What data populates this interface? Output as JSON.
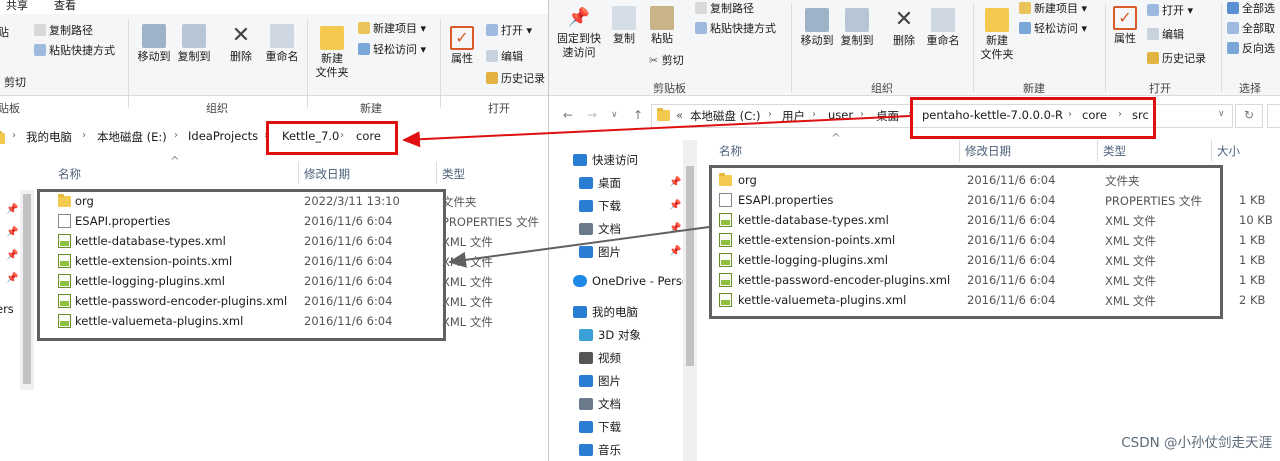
{
  "left": {
    "ribbon_tabs": [
      "共享",
      "查看"
    ],
    "ribbon": {
      "paste_partial": "贴",
      "cut": "剪切",
      "clipboard_label": "贴板",
      "copy_path": "复制路径",
      "paste_shortcut": "粘贴快捷方式",
      "move_to": "移动到",
      "copy_to": "复制到",
      "delete": "删除",
      "rename": "重命名",
      "organize_label": "组织",
      "new_folder": "新建\n文件夹",
      "new_item": "新建项目",
      "easy_access": "轻松访问",
      "new_label": "新建",
      "properties": "属性",
      "open": "打开",
      "edit": "编辑",
      "history": "历史记录",
      "open_label": "打开"
    },
    "breadcrumb": [
      "我的电脑",
      "本地磁盘 (E:)",
      "IdeaProjects",
      "Kettle_7.0",
      "core"
    ],
    "columns": {
      "name": "名称",
      "date": "修改日期",
      "type": "类型"
    },
    "nav_partial": "ers",
    "files": [
      {
        "name": "org",
        "date": "2022/3/11 13:10",
        "type": "文件夹",
        "kind": "folder"
      },
      {
        "name": "ESAPI.properties",
        "date": "2016/11/6 6:04",
        "type": "PROPERTIES 文件",
        "kind": "doc"
      },
      {
        "name": "kettle-database-types.xml",
        "date": "2016/11/6 6:04",
        "type": "XML 文件",
        "kind": "xml"
      },
      {
        "name": "kettle-extension-points.xml",
        "date": "2016/11/6 6:04",
        "type": "XML 文件",
        "kind": "xml"
      },
      {
        "name": "kettle-logging-plugins.xml",
        "date": "2016/11/6 6:04",
        "type": "XML 文件",
        "kind": "xml"
      },
      {
        "name": "kettle-password-encoder-plugins.xml",
        "date": "2016/11/6 6:04",
        "type": "XML 文件",
        "kind": "xml"
      },
      {
        "name": "kettle-valuemeta-plugins.xml",
        "date": "2016/11/6 6:04",
        "type": "XML 文件",
        "kind": "xml"
      }
    ]
  },
  "right": {
    "ribbon": {
      "pin_quick": "固定到快\n速访问",
      "copy": "复制",
      "paste": "粘贴",
      "copy_path": "复制路径",
      "paste_shortcut": "粘贴快捷方式",
      "cut": "剪切",
      "clipboard_label": "剪贴板",
      "move_to": "移动到",
      "copy_to": "复制到",
      "delete": "删除",
      "rename": "重命名",
      "organize_label": "组织",
      "new_folder": "新建\n文件夹",
      "new_item": "新建项目",
      "easy_access": "轻松访问",
      "new_label": "新建",
      "properties": "属性",
      "open": "打开",
      "edit": "编辑",
      "history": "历史记录",
      "open_label": "打开",
      "select_all": "全部选",
      "select_none": "全部取",
      "invert": "反向选",
      "select_label": "选择"
    },
    "breadcrumb_prefix": "«",
    "breadcrumb": [
      "本地磁盘 (C:)",
      "用户",
      "user",
      "桌面",
      "pentaho-kettle-7.0.0.0-R",
      "core",
      "src"
    ],
    "columns": {
      "name": "名称",
      "date": "修改日期",
      "type": "类型",
      "size": "大小"
    },
    "nav": [
      {
        "label": "快速访问",
        "icon": "star-icon",
        "color": "#2b7cd3"
      },
      {
        "label": "桌面",
        "icon": "desktop-icon",
        "color": "#2b7cd3",
        "pinned": true
      },
      {
        "label": "下载",
        "icon": "download-icon",
        "color": "#2b7cd3",
        "pinned": true
      },
      {
        "label": "文档",
        "icon": "document-icon",
        "color": "#6b7b8c",
        "pinned": true
      },
      {
        "label": "图片",
        "icon": "picture-icon",
        "color": "#2b7cd3",
        "pinned": true
      },
      {
        "label": "OneDrive - Perso",
        "icon": "cloud-icon",
        "color": "#1e88e5"
      },
      {
        "label": "我的电脑",
        "icon": "computer-icon",
        "color": "#2b7cd3"
      },
      {
        "label": "3D 对象",
        "icon": "cube-icon",
        "color": "#3aa0d8"
      },
      {
        "label": "视频",
        "icon": "video-icon",
        "color": "#555"
      },
      {
        "label": "图片",
        "icon": "picture-icon",
        "color": "#2b7cd3"
      },
      {
        "label": "文档",
        "icon": "document-icon",
        "color": "#6b7b8c"
      },
      {
        "label": "下载",
        "icon": "download-icon",
        "color": "#2b7cd3"
      },
      {
        "label": "音乐",
        "icon": "music-icon",
        "color": "#2b7cd3"
      }
    ],
    "files": [
      {
        "name": "org",
        "date": "2016/11/6 6:04",
        "type": "文件夹",
        "size": "",
        "kind": "folder"
      },
      {
        "name": "ESAPI.properties",
        "date": "2016/11/6 6:04",
        "type": "PROPERTIES 文件",
        "size": "1 KB",
        "kind": "doc"
      },
      {
        "name": "kettle-database-types.xml",
        "date": "2016/11/6 6:04",
        "type": "XML 文件",
        "size": "10 KB",
        "kind": "xml"
      },
      {
        "name": "kettle-extension-points.xml",
        "date": "2016/11/6 6:04",
        "type": "XML 文件",
        "size": "1 KB",
        "kind": "xml"
      },
      {
        "name": "kettle-logging-plugins.xml",
        "date": "2016/11/6 6:04",
        "type": "XML 文件",
        "size": "1 KB",
        "kind": "xml"
      },
      {
        "name": "kettle-password-encoder-plugins.xml",
        "date": "2016/11/6 6:04",
        "type": "XML 文件",
        "size": "1 KB",
        "kind": "xml"
      },
      {
        "name": "kettle-valuemeta-plugins.xml",
        "date": "2016/11/6 6:04",
        "type": "XML 文件",
        "size": "2 KB",
        "kind": "xml"
      }
    ]
  },
  "watermark": "CSDN @小孙仗剑走天涯",
  "colors": {
    "annotation_red": "#e01010",
    "annotation_gray": "#616161",
    "accent_blue": "#2b7cd3"
  }
}
